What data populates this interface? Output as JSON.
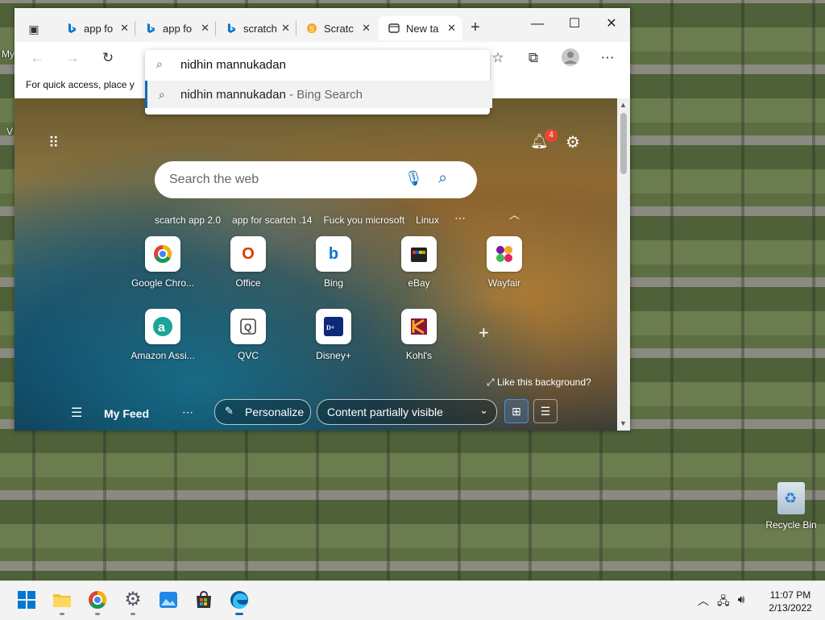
{
  "desktop": {
    "side_text_1": "My",
    "side_text_2": "V",
    "recycle_bin": "Recycle Bin"
  },
  "browser": {
    "tabs": [
      {
        "label": "app fo",
        "icon": "bing-icon"
      },
      {
        "label": "app fo",
        "icon": "bing-icon"
      },
      {
        "label": "scratch",
        "icon": "bing-icon"
      },
      {
        "label": "Scratc",
        "icon": "scratch-icon"
      },
      {
        "label": "New ta",
        "icon": "new-tab-icon",
        "active": true
      }
    ],
    "address_value": "nidhin mannukadan",
    "suggestion_main": "nidhin mannukadan",
    "suggestion_sub": " - Bing Search",
    "favbar_text": "For quick access, place y"
  },
  "ntp": {
    "notification_count": "4",
    "search_placeholder": "Search the web",
    "recent_searches": [
      "scartch app 2.0",
      "app for scartch .14",
      "Fuck you microsoft",
      "Linux"
    ],
    "tiles": [
      {
        "label": "Google Chro...",
        "icon": "chrome-icon",
        "color": "#db4437"
      },
      {
        "label": "Office",
        "icon": "office-icon",
        "color": "#d83b01"
      },
      {
        "label": "Bing",
        "icon": "bing-icon",
        "color": "#0078d4"
      },
      {
        "label": "eBay",
        "icon": "ebay-icon",
        "color": "#e53238"
      },
      {
        "label": "Wayfair",
        "icon": "wayfair-icon",
        "color": "#7b189f"
      },
      {
        "label": "Amazon Assi...",
        "icon": "amazon-assistant-icon",
        "color": "#1ba49a"
      },
      {
        "label": "QVC",
        "icon": "qvc-icon",
        "color": "#444444"
      },
      {
        "label": "Disney+",
        "icon": "disney-plus-icon",
        "color": "#113ccf"
      },
      {
        "label": "Kohl's",
        "icon": "kohls-icon",
        "color": "#8a1538"
      }
    ],
    "like_background": "Like this background?",
    "my_feed": "My Feed",
    "personalize": "Personalize",
    "content_visibility": "Content partially visible"
  },
  "taskbar": {
    "time": "11:07 PM",
    "date": "2/13/2022"
  },
  "colors": {
    "accent": "#0f6cbd",
    "badge": "#e8462e"
  }
}
